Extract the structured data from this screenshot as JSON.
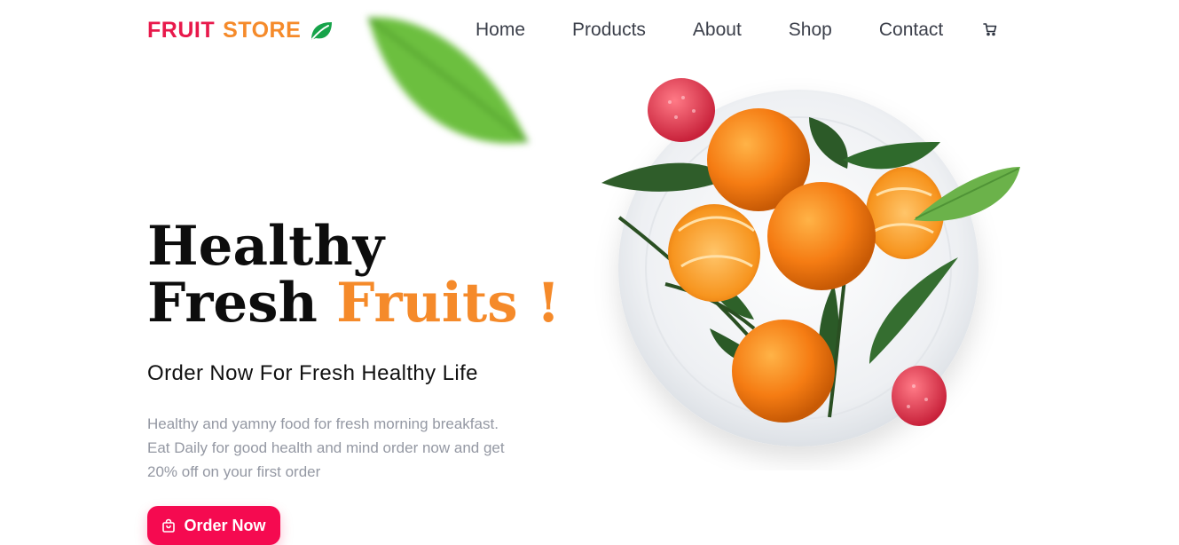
{
  "brand": {
    "part1": "FRUIT",
    "part2": "STORE",
    "icon": "leaf-icon"
  },
  "nav": {
    "items": [
      "Home",
      "Products",
      "About",
      "Shop",
      "Contact"
    ],
    "cart_icon": "cart-icon"
  },
  "hero": {
    "title_line1": "Healthy",
    "title_line2_prefix": "Fresh",
    "title_line2_highlight": "Fruits !",
    "subtitle": "Order Now For Fresh Healthy Life",
    "description_lines": [
      "Healthy and yamny food for fresh morning breakfast.",
      "Eat Daily for good health and mind order now and get",
      "20% off on your first order"
    ],
    "cta_label": "Order Now",
    "cta_icon": "shopping-bag-icon"
  },
  "colors": {
    "brand_red": "#e8194b",
    "brand_orange": "#f58a2a",
    "button": "#f50a50",
    "leaf_green": "#16a34a"
  }
}
